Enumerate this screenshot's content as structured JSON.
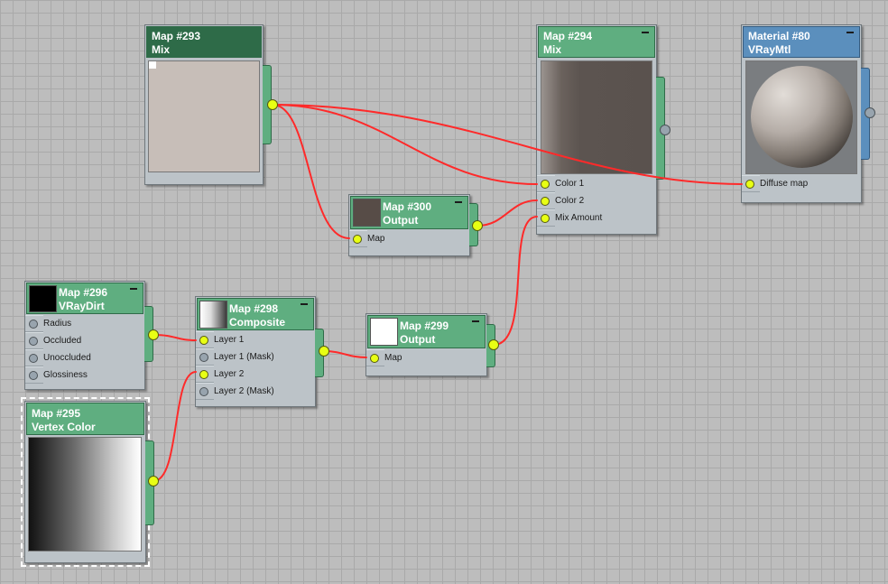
{
  "nodes": {
    "n293": {
      "id": "Map #293",
      "type": "Mix"
    },
    "n294": {
      "id": "Map #294",
      "type": "Mix",
      "slots": [
        "Color 1",
        "Color 2",
        "Mix Amount"
      ]
    },
    "n80": {
      "id": "Material #80",
      "type": "VRayMtl",
      "slots": [
        "Diffuse map"
      ]
    },
    "n300": {
      "id": "Map #300",
      "type": "Output",
      "slots": [
        "Map"
      ]
    },
    "n296": {
      "id": "Map #296",
      "type": "VRayDirt",
      "slots": [
        "Radius",
        "Occluded",
        "Unoccluded",
        "Glossiness"
      ]
    },
    "n298": {
      "id": "Map #298",
      "type": "Composite",
      "slots": [
        "Layer 1",
        "Layer 1 (Mask)",
        "Layer 2",
        "Layer 2 (Mask)"
      ]
    },
    "n299": {
      "id": "Map #299",
      "type": "Output",
      "slots": [
        "Map"
      ]
    },
    "n295": {
      "id": "Map #295",
      "type": "Vertex Color"
    }
  },
  "colors": {
    "wire": "#ff2020",
    "port_connected": "#e8ff14",
    "map_header": "#5fae80",
    "material_header": "#5b8fbd"
  },
  "connections": [
    {
      "from": "Map #293",
      "to": "Map #294 / Color 1"
    },
    {
      "from": "Map #293",
      "to": "Material #80 / Diffuse map"
    },
    {
      "from": "Map #293",
      "to": "Map #300 / Map"
    },
    {
      "from": "Map #300",
      "to": "Map #294 / Color 2"
    },
    {
      "from": "Map #296",
      "to": "Map #298 / Layer 1"
    },
    {
      "from": "Map #295",
      "to": "Map #298 / Layer 2"
    },
    {
      "from": "Map #298",
      "to": "Map #299 / Map"
    },
    {
      "from": "Map #299",
      "to": "Map #294 / Mix Amount"
    }
  ]
}
